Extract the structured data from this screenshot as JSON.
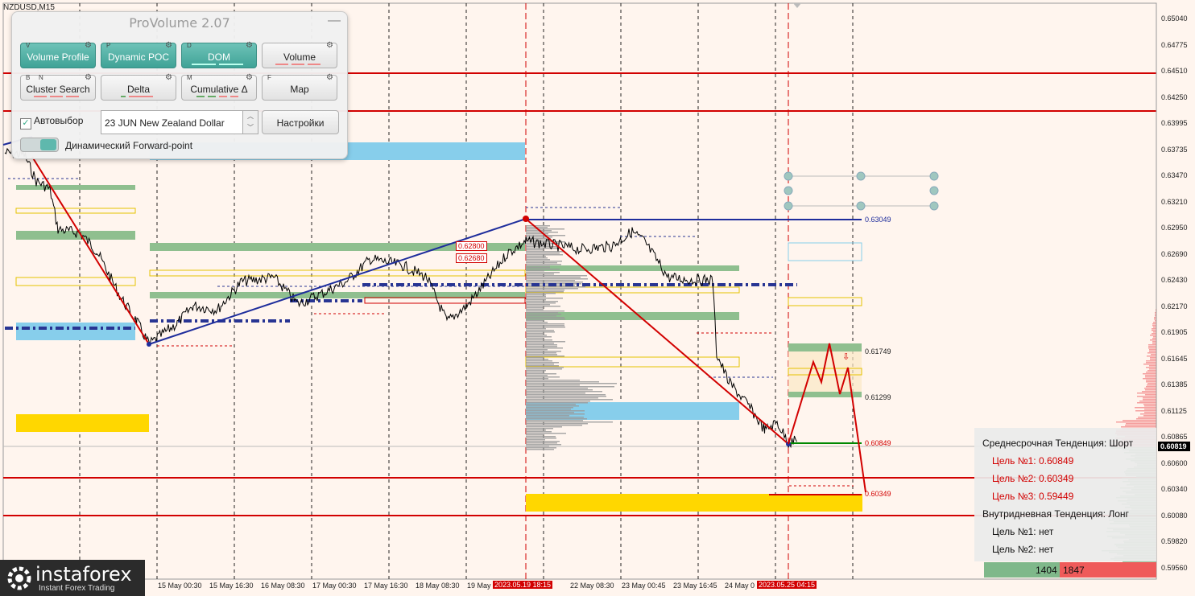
{
  "symbol": "NZDUSD,M15",
  "panel": {
    "title": "ProVolume 2.07",
    "minimize": "—",
    "buttons": [
      {
        "key": "V",
        "label": "Volume Profile",
        "on": true
      },
      {
        "key": "P",
        "label": "Dynamic POC",
        "on": true
      },
      {
        "key": "D",
        "label": "DOM",
        "on": true
      },
      {
        "key": "",
        "label": "Volume",
        "on": false
      },
      {
        "key": "B",
        "key2": "N",
        "label": "Cluster Search",
        "on": false
      },
      {
        "key": "",
        "label": "Delta",
        "on": false
      },
      {
        "key": "M",
        "label": "Cumulative Δ",
        "on": false
      },
      {
        "key": "F",
        "label": "Map",
        "on": false
      }
    ],
    "autoselect_label": "Автовыбор",
    "autoselect_checked": true,
    "contract": "23 JUN New Zealand Dollar",
    "settings_label": "Настройки",
    "dynamic_forward_label": "Динамический Forward-point"
  },
  "price_axis": [
    "0.65040",
    "0.64775",
    "0.64510",
    "0.64250",
    "0.63995",
    "0.63735",
    "0.63470",
    "0.63210",
    "0.62950",
    "0.62690",
    "0.62430",
    "0.62170",
    "0.61905",
    "0.61645",
    "0.61385",
    "0.61125",
    "0.60865",
    "0.60600",
    "0.60340",
    "0.60080",
    "0.59820",
    "0.59560"
  ],
  "current_price": "0.60819",
  "time_axis": [
    "15 May 00:30",
    "15 May 16:30",
    "16 May 08:30",
    "17 May 00:30",
    "17 May 16:30",
    "18 May 08:30",
    "19 May 00:30",
    "22 May 08:30",
    "23 May 00:45",
    "23 May 16:45",
    "24 May 0"
  ],
  "highlighted_times": [
    "2023.05.19 18:15",
    "2023.05.25 04:15"
  ],
  "level_labels": {
    "l1": "0.63049",
    "l2": "0.61749",
    "l3": "0.61299",
    "l4": "0.60849",
    "l5": "0.60349"
  },
  "box_labels": [
    "0.62800",
    "0.62680"
  ],
  "info": {
    "medium_trend": "Среднесрочная Тенденция: Шорт",
    "targets_short": [
      "Цель №1: 0.60849",
      "Цель №2: 0.60349",
      "Цель №3: 0.59449"
    ],
    "intraday_trend": "Внутридневная Тенденция: Лонг",
    "targets_long": [
      "Цель №1: нет",
      "Цель №2: нет"
    ]
  },
  "dom": {
    "bid": "1404",
    "ask": "1847"
  },
  "logo": {
    "name": "instaforex",
    "tagline": "Instant Forex Trading"
  },
  "colors": {
    "background": "#fff5ee",
    "red": "#d20000",
    "blue": "#1e2d9c",
    "green": "#6aa76f",
    "yellow": "#ffd700",
    "lightblue": "#87ceeb"
  }
}
